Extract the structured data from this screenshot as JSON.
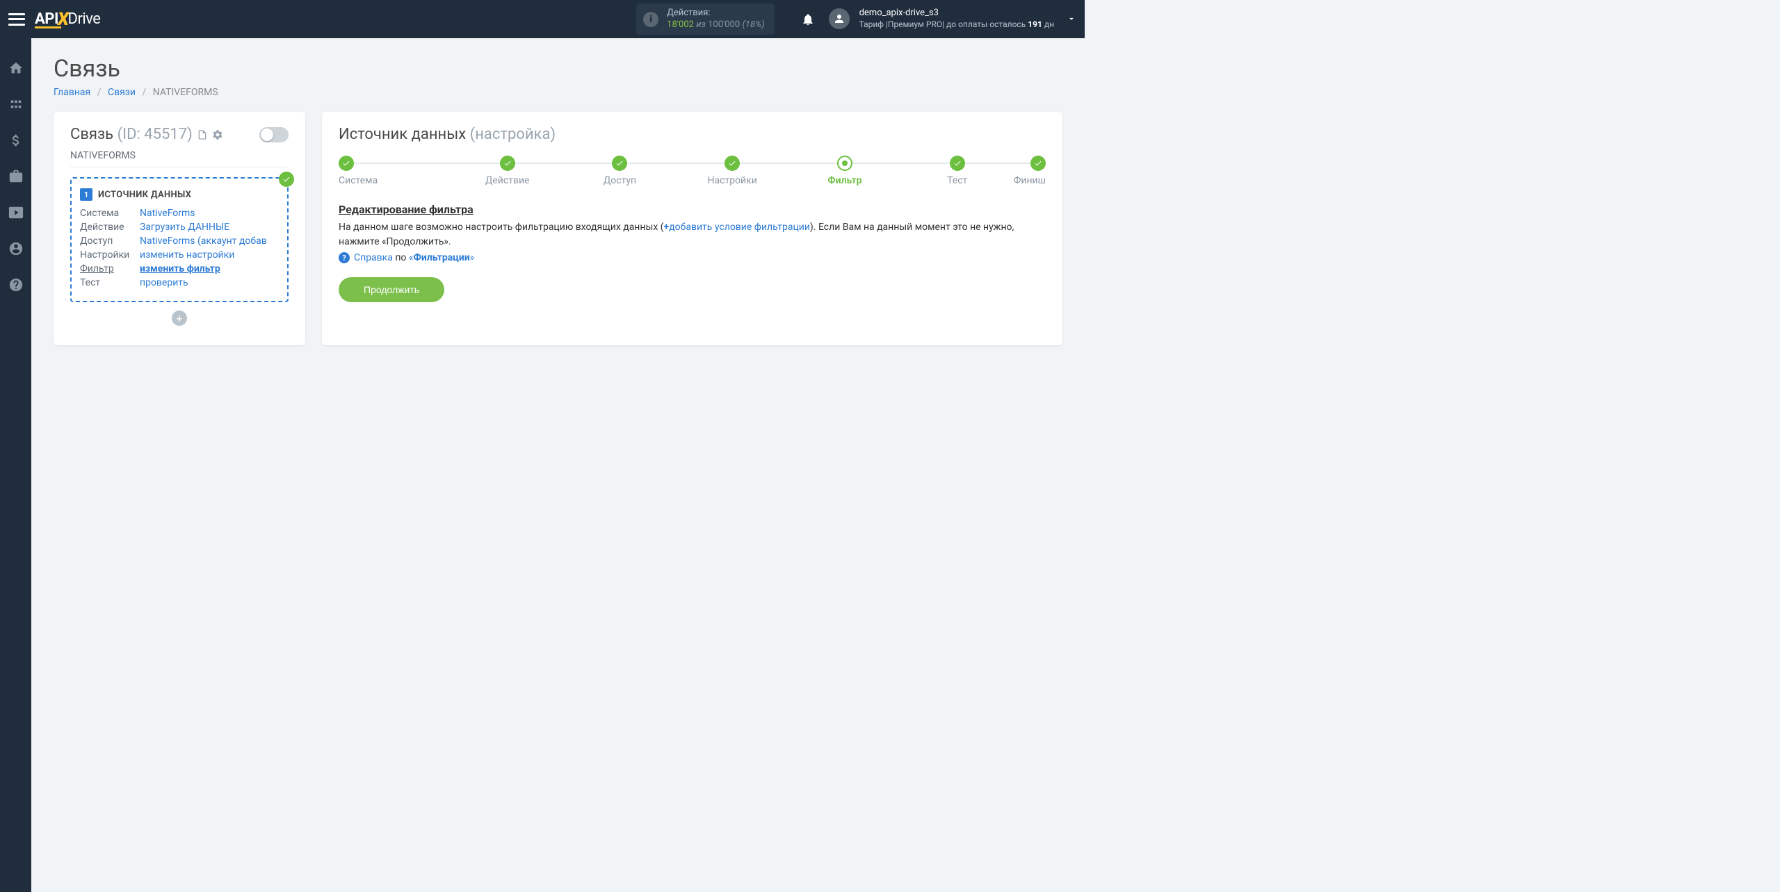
{
  "header": {
    "logo": {
      "api": "API",
      "drive": "Drive"
    },
    "actions": {
      "label": "Действия:",
      "used": "18'002",
      "iz": "из",
      "total": "100'000",
      "pct": "(18%)"
    },
    "user": {
      "name": "demo_apix-drive_s3",
      "tariff_prefix": "Тариф |Премиум PRO| до оплаты осталось ",
      "days": "191",
      "days_suffix": " дн"
    }
  },
  "page": {
    "title": "Связь",
    "breadcrumb": {
      "home": "Главная",
      "links": "Связи",
      "current": "NATIVEFORMS"
    }
  },
  "left": {
    "title": "Связь",
    "id_label": "(ID: 45517)",
    "conn_name": "NATIVEFORMS",
    "source_badge": "1",
    "source_title": "ИСТОЧНИК ДАННЫХ",
    "rows": {
      "system": {
        "lbl": "Система",
        "val": "NativeForms"
      },
      "action": {
        "lbl": "Действие",
        "val": "Загрузить ДАННЫЕ"
      },
      "access": {
        "lbl": "Доступ",
        "val": "NativeForms (аккаунт добав"
      },
      "settings": {
        "lbl": "Настройки",
        "val": "изменить настройки"
      },
      "filter": {
        "lbl": "Фильтр",
        "val": "изменить фильтр"
      },
      "test": {
        "lbl": "Тест",
        "val": "проверить"
      }
    }
  },
  "right": {
    "title": "Источник данных",
    "subtitle": "(настройка)",
    "steps": [
      {
        "label": "Система",
        "state": "done"
      },
      {
        "label": "Действие",
        "state": "done"
      },
      {
        "label": "Доступ",
        "state": "done"
      },
      {
        "label": "Настройки",
        "state": "done"
      },
      {
        "label": "Фильтр",
        "state": "current"
      },
      {
        "label": "Тест",
        "state": "done"
      },
      {
        "label": "Финиш",
        "state": "done"
      }
    ],
    "section_title": "Редактирование фильтра",
    "text_before": "На данном шаге возможно настроить фильтрацию входящих данных (",
    "add_link": "добавить условие фильтрации",
    "text_after": "). Если Вам на данный момент это не нужно, нажмите «Продолжить».",
    "help": {
      "link": "Справка",
      "po": "по",
      "open": "«",
      "strong": "Фильтрации",
      "close": "»"
    },
    "continue": "Продолжить"
  }
}
